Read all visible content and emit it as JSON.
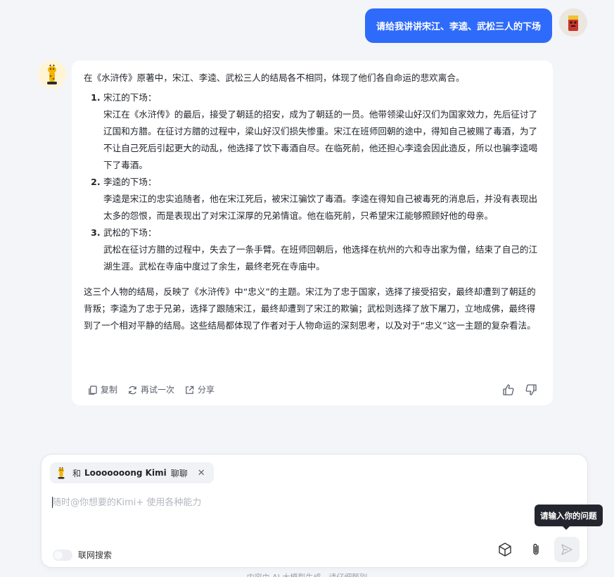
{
  "user_message": {
    "text": "请给我讲讲宋江、李逵、武松三人的下场"
  },
  "bot_message": {
    "intro": "在《水浒传》原著中，宋江、李逵、武松三人的结局各不相同，体现了他们各自命运的悲欢离合。",
    "items": [
      {
        "title": "宋江的下场：",
        "body": "宋江在《水浒传》的最后，接受了朝廷的招安，成为了朝廷的一员。他带领梁山好汉们为国家效力，先后征讨了辽国和方腊。在征讨方腊的过程中，梁山好汉们损失惨重。宋江在班师回朝的途中，得知自己被赐了毒酒，为了不让自己死后引起更大的动乱，他选择了饮下毒酒自尽。在临死前，他还担心李逵会因此造反，所以也骗李逵喝下了毒酒。"
      },
      {
        "title": "李逵的下场：",
        "body": "李逵是宋江的忠实追随者，他在宋江死后，被宋江骗饮了毒酒。李逵在得知自己被毒死的消息后，并没有表现出太多的怨恨，而是表现出了对宋江深厚的兄弟情谊。他在临死前，只希望宋江能够照顾好他的母亲。"
      },
      {
        "title": "武松的下场：",
        "body": "武松在征讨方腊的过程中，失去了一条手臂。在班师回朝后，他选择在杭州的六和寺出家为僧，结束了自己的江湖生涯。武松在寺庙中度过了余生，最终老死在寺庙中。"
      }
    ],
    "summary": "这三个人物的结局，反映了《水浒传》中“忠义”的主题。宋江为了忠于国家，选择了接受招安，最终却遭到了朝廷的背叛；李逵为了忠于兄弟，选择了跟随宋江，最终却遭到了宋江的欺骗；武松则选择了放下屠刀，立地成佛，最终得到了一个相对平静的结局。这些结局都体现了作者对于人物命运的深刻思考，以及对于“忠义”这一主题的复杂看法。",
    "actions": {
      "copy": "复制",
      "retry": "再试一次",
      "share": "分享"
    }
  },
  "input": {
    "chip": {
      "prefix": "和",
      "name": "Looooooong Kimi",
      "suffix": "聊聊",
      "close": "✕"
    },
    "placeholder": "随时@你想要的Kimi+ 使用各种能力",
    "value": "",
    "web_search_label": "联网搜索",
    "web_search_enabled": false,
    "tooltip": "请输入你的问题"
  },
  "footer_note": "内容由 AI 大模型生成，请仔细甄别",
  "colors": {
    "accent": "#2f6bfa",
    "background": "#f4f5f9",
    "tooltip_bg": "#23262e"
  }
}
